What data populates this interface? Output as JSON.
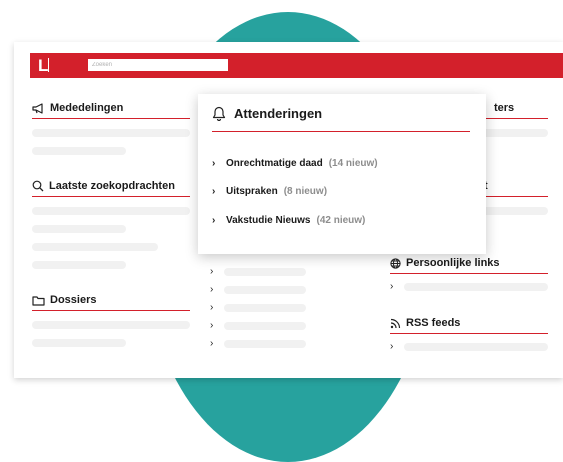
{
  "header": {
    "logo": "L",
    "search_placeholder": "Zoeken"
  },
  "left": {
    "announcements_title": "Mededelingen",
    "searches_title": "Laatste zoekopdrachten",
    "dossiers_title": "Dossiers"
  },
  "right": {
    "partial_title_1": "ters",
    "partial_title_2": "t",
    "links_title": "Persoonlijke links",
    "rss_title": "RSS feeds"
  },
  "alerts": {
    "title": "Attenderingen",
    "items": [
      {
        "label": "Onrechtmatige daad",
        "count": "(14 nieuw)"
      },
      {
        "label": "Uitspraken",
        "count": "(8 nieuw)"
      },
      {
        "label": "Vakstudie Nieuws",
        "count": "(42 nieuw)"
      }
    ]
  },
  "colors": {
    "accent": "#d3202b",
    "teal": "#27a29e",
    "placeholder_bar": "#f1f1f1"
  },
  "icons": [
    "megaphone-icon",
    "search-icon",
    "folder-icon",
    "bell-icon",
    "globe-icon",
    "rss-icon",
    "chevron-right-icon"
  ]
}
